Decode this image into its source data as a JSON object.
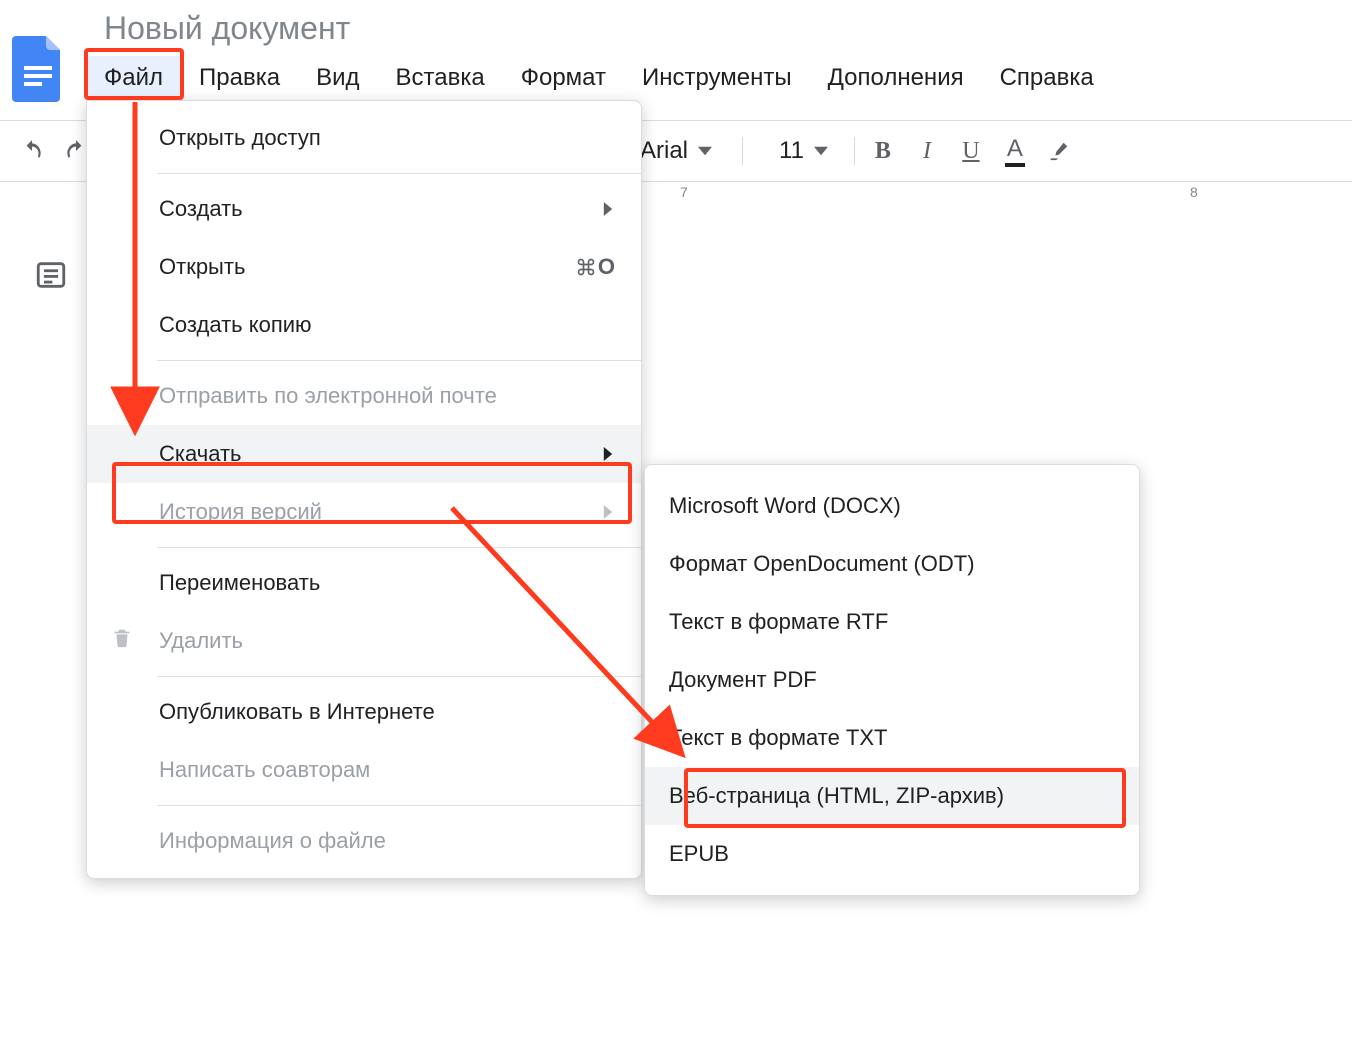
{
  "doc": {
    "title": "Новый документ"
  },
  "menubar": {
    "file": "Файл",
    "edit": "Правка",
    "view": "Вид",
    "insert": "Вставка",
    "format": "Формат",
    "tools": "Инструменты",
    "addons": "Дополнения",
    "help": "Справка"
  },
  "toolbar": {
    "font": "Arial",
    "size": "11"
  },
  "ruler": {
    "labels": [
      "7",
      "8"
    ]
  },
  "file_menu": {
    "share": "Открыть доступ",
    "new": "Создать",
    "open": "Открыть",
    "open_shortcut": "O",
    "make_copy": "Создать копию",
    "email": "Отправить по электронной почте",
    "download": "Скачать",
    "version_history": "История версий",
    "rename": "Переименовать",
    "delete": "Удалить",
    "publish": "Опубликовать в Интернете",
    "email_collab": "Написать соавторам",
    "details": "Информация о файле"
  },
  "download_submenu": {
    "docx": "Microsoft Word (DOCX)",
    "odt": "Формат OpenDocument (ODT)",
    "rtf": "Текст в формате RTF",
    "pdf": "Документ PDF",
    "txt": "Текст в формате TXT",
    "html": "Веб-страница (HTML, ZIP-архив)",
    "epub": "EPUB"
  }
}
